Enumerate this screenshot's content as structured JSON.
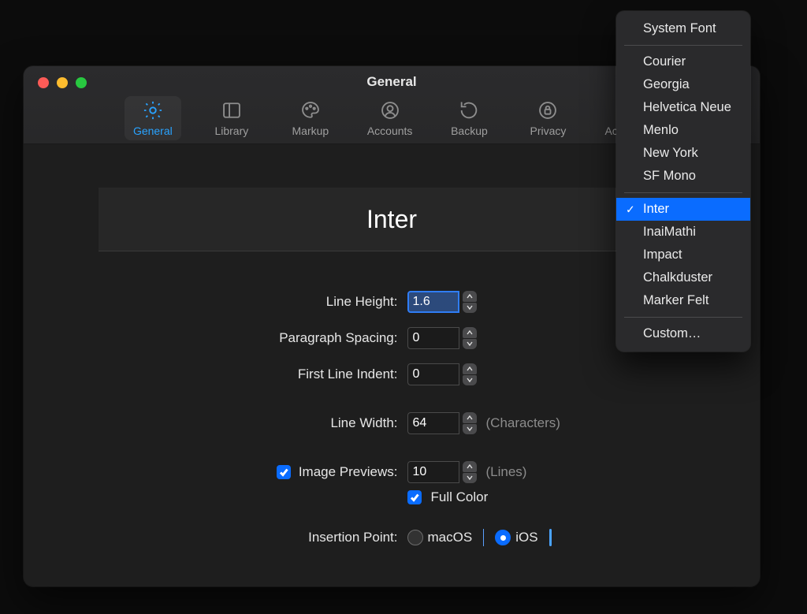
{
  "window": {
    "title": "General"
  },
  "toolbar": {
    "items": [
      {
        "label": "General"
      },
      {
        "label": "Library"
      },
      {
        "label": "Markup"
      },
      {
        "label": "Accounts"
      },
      {
        "label": "Backup"
      },
      {
        "label": "Privacy"
      },
      {
        "label": "Activation"
      }
    ]
  },
  "font_preview": "Inter",
  "fields": {
    "line_height": {
      "label": "Line Height:",
      "value": "1.6"
    },
    "paragraph_spacing": {
      "label": "Paragraph Spacing:",
      "value": "0"
    },
    "first_line_indent": {
      "label": "First Line Indent:",
      "value": "0"
    },
    "line_width": {
      "label": "Line Width:",
      "value": "64",
      "suffix": "(Characters)"
    },
    "image_previews": {
      "label": "Image Previews:",
      "value": "10",
      "suffix": "(Lines)"
    },
    "full_color": {
      "label": "Full Color"
    },
    "insertion_point": {
      "label": "Insertion Point:",
      "macos": "macOS",
      "ios": "iOS"
    }
  },
  "font_menu": {
    "groups": [
      [
        "System Font"
      ],
      [
        "Courier",
        "Georgia",
        "Helvetica Neue",
        "Menlo",
        "New York",
        "SF Mono"
      ],
      [
        "Inter",
        "InaiMathi",
        "Impact",
        "Chalkduster",
        "Marker Felt"
      ],
      [
        "Custom…"
      ]
    ],
    "selected": "Inter"
  }
}
